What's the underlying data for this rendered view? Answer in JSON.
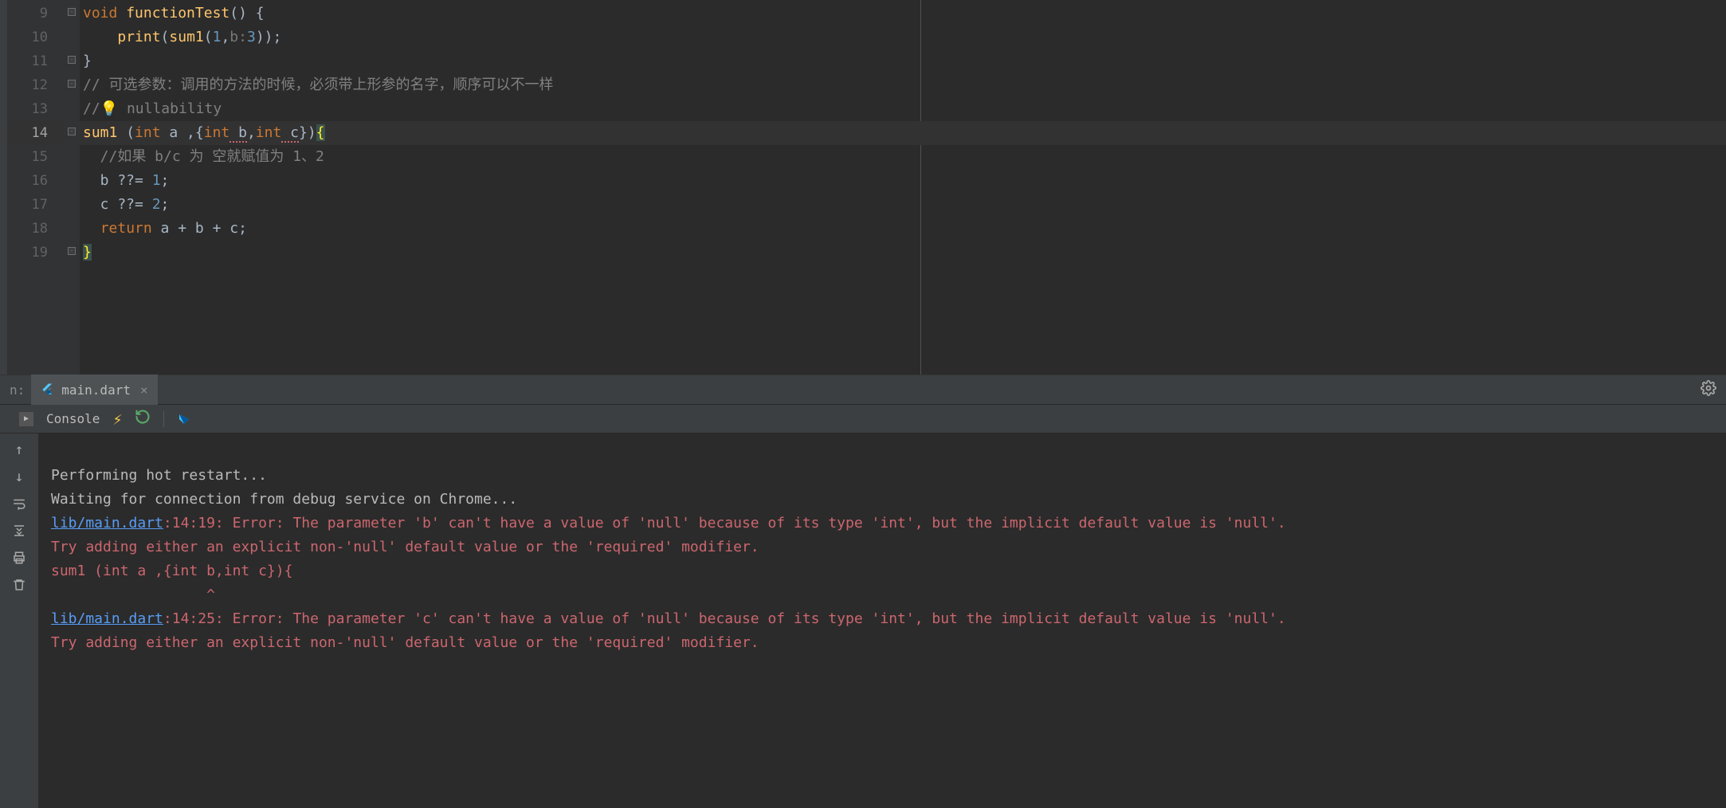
{
  "editor": {
    "lines": [
      {
        "num": "9"
      },
      {
        "num": "10"
      },
      {
        "num": "11"
      },
      {
        "num": "12"
      },
      {
        "num": "13"
      },
      {
        "num": "14",
        "current": true
      },
      {
        "num": "15"
      },
      {
        "num": "16"
      },
      {
        "num": "17"
      },
      {
        "num": "18"
      },
      {
        "num": "19"
      }
    ],
    "code": {
      "l9_void": "void",
      "l9_fn": " functionTest",
      "l9_rest": "() {",
      "l10_indent": "    ",
      "l10_print": "print",
      "l10_open": "(",
      "l10_sum1": "sum1",
      "l10_p1": "(",
      "l10_n1": "1",
      "l10_comma": ",",
      "l10_hint": "b:",
      "l10_n3": "3",
      "l10_close": "));",
      "l11": "}",
      "l12": "// 可选参数：调用的方法的时候，必须带上形参的名字，顺序可以不一样",
      "l13_pre": "//",
      "l13_txt": " nullability",
      "l14_sum1": "sum1 ",
      "l14_open": "(",
      "l14_int1": "int",
      "l14_a": " a ,{",
      "l14_int2": "int",
      "l14_b": " b",
      "l14_comma": ",",
      "l14_int3": "int",
      "l14_c": " c",
      "l14_close": "})",
      "l14_brace": "{",
      "l15": "  //如果 b/c 为 空就赋值为 1、2",
      "l16_pre": "  b ??= ",
      "l16_n": "1",
      "l16_semi": ";",
      "l17_pre": "  c ??= ",
      "l17_n": "2",
      "l17_semi": ";",
      "l18_pre": "  ",
      "l18_ret": "return",
      "l18_expr": " a + b + c;",
      "l19": "}"
    }
  },
  "tabbar": {
    "left_label": "n:",
    "tab_label": "main.dart"
  },
  "console_toolbar": {
    "label": "Console"
  },
  "console": {
    "line1": "Performing hot restart...",
    "line2": "Waiting for connection from debug service on Chrome...",
    "err1_link": "lib/main.dart",
    "err1_loc": ":14:19: Error: The parameter 'b' can't have a value of 'null' because of its type 'int', but the implicit default value is 'null'.",
    "err1_hint": "Try adding either an explicit non-'null' default value or the 'required' modifier.",
    "err1_code": "sum1 (int a ,{int b,int c}){",
    "err1_caret": "                  ^",
    "err2_link": "lib/main.dart",
    "err2_loc": ":14:25: Error: The parameter 'c' can't have a value of 'null' because of its type 'int', but the implicit default value is 'null'.",
    "err2_hint": "Try adding either an explicit non-'null' default value or the 'required' modifier."
  }
}
